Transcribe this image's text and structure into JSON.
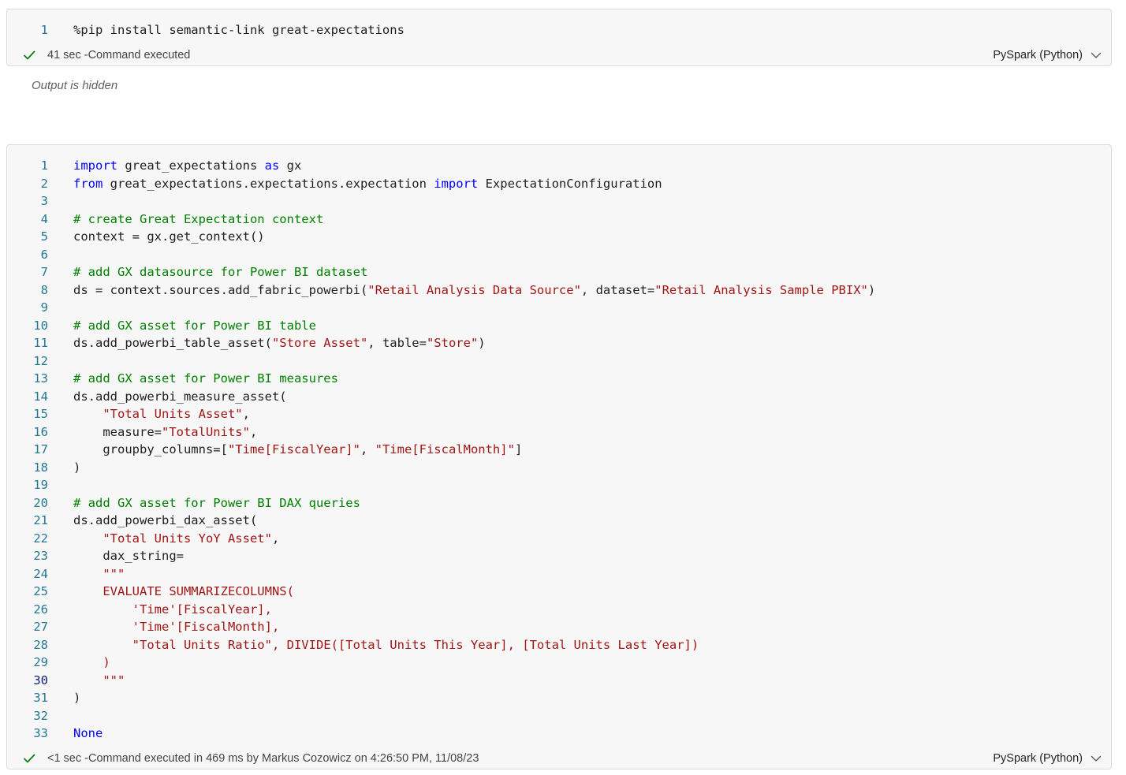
{
  "cells": [
    {
      "code_lines": [
        {
          "n": "1",
          "tokens": [
            {
              "t": "%pip install semantic-link great-expectations",
              "k": "pl"
            }
          ]
        }
      ],
      "status": {
        "text": "41 sec -Command executed",
        "language": "PySpark (Python)"
      },
      "output_note": "Output is hidden"
    },
    {
      "code_lines": [
        {
          "n": "1",
          "tokens": [
            {
              "t": "import",
              "k": "kw"
            },
            {
              "t": " great_expectations ",
              "k": "pl"
            },
            {
              "t": "as",
              "k": "kw"
            },
            {
              "t": " gx",
              "k": "pl"
            }
          ]
        },
        {
          "n": "2",
          "tokens": [
            {
              "t": "from",
              "k": "kw"
            },
            {
              "t": " great_expectations.expectations.expectation ",
              "k": "pl"
            },
            {
              "t": "import",
              "k": "kw"
            },
            {
              "t": " ExpectationConfiguration",
              "k": "pl"
            }
          ]
        },
        {
          "n": "3",
          "tokens": []
        },
        {
          "n": "4",
          "tokens": [
            {
              "t": "# create Great Expectation context",
              "k": "cm"
            }
          ]
        },
        {
          "n": "5",
          "tokens": [
            {
              "t": "context = gx.get_context()",
              "k": "pl"
            }
          ]
        },
        {
          "n": "6",
          "tokens": []
        },
        {
          "n": "7",
          "tokens": [
            {
              "t": "# add GX datasource for Power BI dataset",
              "k": "cm"
            }
          ]
        },
        {
          "n": "8",
          "tokens": [
            {
              "t": "ds = context.sources.add_fabric_powerbi(",
              "k": "pl"
            },
            {
              "t": "\"Retail Analysis Data Source\"",
              "k": "str"
            },
            {
              "t": ", dataset=",
              "k": "pl"
            },
            {
              "t": "\"Retail Analysis Sample PBIX\"",
              "k": "str"
            },
            {
              "t": ")",
              "k": "pl"
            }
          ]
        },
        {
          "n": "9",
          "tokens": []
        },
        {
          "n": "10",
          "tokens": [
            {
              "t": "# add GX asset for Power BI table",
              "k": "cm"
            }
          ]
        },
        {
          "n": "11",
          "tokens": [
            {
              "t": "ds.add_powerbi_table_asset(",
              "k": "pl"
            },
            {
              "t": "\"Store Asset\"",
              "k": "str"
            },
            {
              "t": ", table=",
              "k": "pl"
            },
            {
              "t": "\"Store\"",
              "k": "str"
            },
            {
              "t": ")",
              "k": "pl"
            }
          ]
        },
        {
          "n": "12",
          "tokens": []
        },
        {
          "n": "13",
          "tokens": [
            {
              "t": "# add GX asset for Power BI measures",
              "k": "cm"
            }
          ]
        },
        {
          "n": "14",
          "tokens": [
            {
              "t": "ds.add_powerbi_measure_asset(",
              "k": "pl"
            }
          ]
        },
        {
          "n": "15",
          "tokens": [
            {
              "t": "    ",
              "k": "pl"
            },
            {
              "t": "\"Total Units Asset\"",
              "k": "str"
            },
            {
              "t": ",",
              "k": "pl"
            }
          ]
        },
        {
          "n": "16",
          "tokens": [
            {
              "t": "    measure=",
              "k": "pl"
            },
            {
              "t": "\"TotalUnits\"",
              "k": "str"
            },
            {
              "t": ",",
              "k": "pl"
            }
          ]
        },
        {
          "n": "17",
          "tokens": [
            {
              "t": "    groupby_columns=[",
              "k": "pl"
            },
            {
              "t": "\"Time[FiscalYear]\"",
              "k": "str"
            },
            {
              "t": ", ",
              "k": "pl"
            },
            {
              "t": "\"Time[FiscalMonth]\"",
              "k": "str"
            },
            {
              "t": "]",
              "k": "pl"
            }
          ]
        },
        {
          "n": "18",
          "tokens": [
            {
              "t": ")",
              "k": "pl"
            }
          ]
        },
        {
          "n": "19",
          "tokens": []
        },
        {
          "n": "20",
          "tokens": [
            {
              "t": "# add GX asset for Power BI DAX queries",
              "k": "cm"
            }
          ]
        },
        {
          "n": "21",
          "tokens": [
            {
              "t": "ds.add_powerbi_dax_asset(",
              "k": "pl"
            }
          ]
        },
        {
          "n": "22",
          "tokens": [
            {
              "t": "    ",
              "k": "pl"
            },
            {
              "t": "\"Total Units YoY Asset\"",
              "k": "str"
            },
            {
              "t": ",",
              "k": "pl"
            }
          ]
        },
        {
          "n": "23",
          "tokens": [
            {
              "t": "    dax_string=",
              "k": "pl"
            }
          ]
        },
        {
          "n": "24",
          "tokens": [
            {
              "t": "    ",
              "k": "pl"
            },
            {
              "t": "\"\"\"",
              "k": "str"
            }
          ]
        },
        {
          "n": "25",
          "tokens": [
            {
              "t": "    EVALUATE SUMMARIZECOLUMNS(",
              "k": "str"
            }
          ]
        },
        {
          "n": "26",
          "tokens": [
            {
              "t": "        'Time'[FiscalYear],",
              "k": "str"
            }
          ]
        },
        {
          "n": "27",
          "tokens": [
            {
              "t": "        'Time'[FiscalMonth],",
              "k": "str"
            }
          ]
        },
        {
          "n": "28",
          "tokens": [
            {
              "t": "        \"Total Units Ratio\", DIVIDE([Total Units This Year], [Total Units Last Year])",
              "k": "str"
            }
          ]
        },
        {
          "n": "29",
          "tokens": [
            {
              "t": "    )",
              "k": "str"
            }
          ]
        },
        {
          "n": "30",
          "active": true,
          "tokens": [
            {
              "t": "    \"\"\"",
              "k": "str"
            }
          ]
        },
        {
          "n": "31",
          "tokens": [
            {
              "t": ")",
              "k": "pl"
            }
          ]
        },
        {
          "n": "32",
          "tokens": []
        },
        {
          "n": "33",
          "tokens": [
            {
              "t": "None",
              "k": "kw"
            }
          ]
        }
      ],
      "status": {
        "text": "<1 sec -Command executed in 469 ms by Markus Cozowicz on 4:26:50 PM, 11/08/23",
        "language": "PySpark (Python)"
      }
    }
  ],
  "colors": {
    "keyword": "#0000ff",
    "string": "#a31515",
    "comment": "#008000",
    "line_number": "#237893",
    "success_check": "#107c10"
  },
  "icons": {
    "status_ok": "check-icon",
    "language_menu": "chevron-down-icon"
  }
}
